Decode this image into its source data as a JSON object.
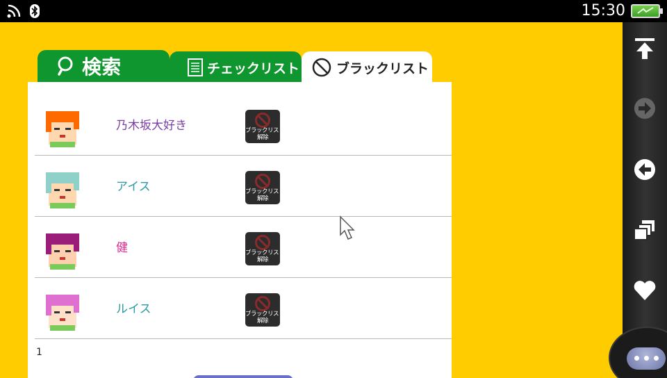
{
  "status": {
    "time": "15:30"
  },
  "tabs": [
    {
      "label": "検索",
      "icon": "search-icon",
      "active": false
    },
    {
      "label": "チェックリスト",
      "icon": "checklist-icon",
      "active": false
    },
    {
      "label": "ブラックリスト",
      "icon": "blacklist-icon",
      "active": true
    }
  ],
  "blacklist": {
    "unblock_label": "ブラックリスト",
    "unblock_sub": "解除",
    "users": [
      {
        "name": "乃木坂大好き",
        "name_color": "#7a3fa6",
        "hair": "#ff6a00",
        "skin": "#ffd8b0"
      },
      {
        "name": "アイス",
        "name_color": "#2a9aa4",
        "hair": "#8fd0c8",
        "skin": "#ffd8b0"
      },
      {
        "name": "健",
        "name_color": "#e0288f",
        "hair": "#9a1d7a",
        "skin": "#ffd0b0"
      },
      {
        "name": "ルイス",
        "name_color": "#2a9aa4",
        "hair": "#e070d0",
        "skin": "#ffe0c8"
      }
    ],
    "page": "1"
  },
  "colors": {
    "background": "#ffcc00",
    "tab_green": "#10962f",
    "button_dark": "#2c2c2c"
  },
  "sidebar_icons": [
    "scroll-top-icon",
    "forward-icon",
    "back-icon",
    "windows-icon",
    "favorite-icon"
  ]
}
